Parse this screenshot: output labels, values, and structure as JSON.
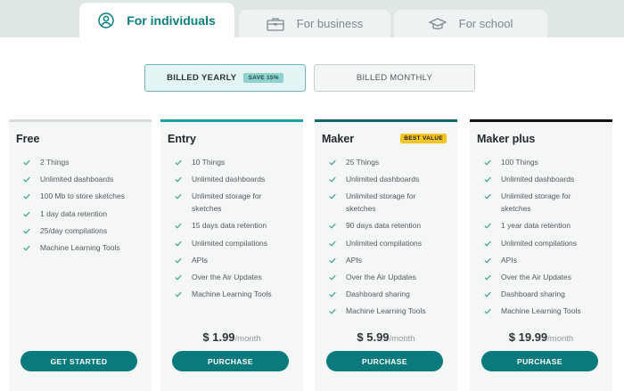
{
  "tabs": [
    {
      "label": "For individuals",
      "icon": "user-icon"
    },
    {
      "label": "For business",
      "icon": "briefcase-icon"
    },
    {
      "label": "For school",
      "icon": "graduation-cap-icon"
    }
  ],
  "billing": {
    "yearly_label": "BILLED YEARLY",
    "save_badge": "SAVE 15%",
    "monthly_label": "BILLED MONTHLY"
  },
  "colors": {
    "accent": "#0b7a7c",
    "best_value": "#f5c525",
    "free_bar": "#d4dcdc",
    "entry_bar": "#1aa1a0",
    "maker_bar": "#0b6a6c",
    "plus_bar": "#111111"
  },
  "plans": [
    {
      "name": "Free",
      "features": [
        "2 Things",
        "Unlimited dashboards",
        "100 Mb to store sketches",
        "1 day data retention",
        "25/day compilations",
        "Machine Learning Tools"
      ],
      "cta": "GET STARTED"
    },
    {
      "name": "Entry",
      "features": [
        "10 Things",
        "Unlimited dashboards",
        "Unlimited storage for sketches",
        "15 days data retention",
        "Unlimited compilations",
        "APIs",
        "Over the Air Updates",
        "Machine Learning Tools"
      ],
      "price": "$ 1.99",
      "per": "/month",
      "cta": "PURCHASE"
    },
    {
      "name": "Maker",
      "badge": "BEST VALUE",
      "features": [
        "25 Things",
        "Unlimited dashboards",
        "Unlimited storage for sketches",
        "90 days data retention",
        "Unlimited compilations",
        "APIs",
        "Over the Air Updates",
        "Dashboard sharing",
        "Machine Learning Tools"
      ],
      "price": "$ 5.99",
      "per": "/month",
      "cta": "PURCHASE"
    },
    {
      "name": "Maker plus",
      "features": [
        "100 Things",
        "Unlimited dashboards",
        "Unlimited storage for sketches",
        "1 year data retention",
        "Unlimited compilations",
        "APIs",
        "Over the Air Updates",
        "Dashboard sharing",
        "Machine Learning Tools"
      ],
      "price": "$ 19.99",
      "per": "/month",
      "cta": "PURCHASE"
    }
  ]
}
